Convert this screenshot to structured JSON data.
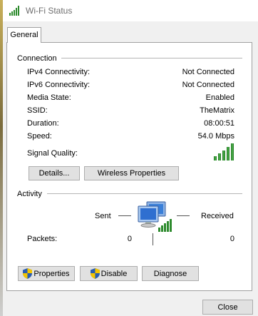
{
  "window": {
    "title": "Wi-Fi Status"
  },
  "tabs": [
    {
      "label": "General"
    }
  ],
  "connection": {
    "section_label": "Connection",
    "rows": [
      {
        "label": "IPv4 Connectivity:",
        "value": "Not Connected"
      },
      {
        "label": "IPv6 Connectivity:",
        "value": "Not Connected"
      },
      {
        "label": "Media State:",
        "value": "Enabled"
      },
      {
        "label": "SSID:",
        "value": "TheMatrix"
      },
      {
        "label": "Duration:",
        "value": "08:00:51"
      },
      {
        "label": "Speed:",
        "value": "54.0 Mbps"
      }
    ],
    "signal_label": "Signal Quality:",
    "signal_bars": 5,
    "details_button": "Details...",
    "wireless_properties_button": "Wireless Properties"
  },
  "activity": {
    "section_label": "Activity",
    "sent_label": "Sent",
    "received_label": "Received",
    "packets_label": "Packets:",
    "packets_sent": "0",
    "packets_received": "0"
  },
  "buttons": {
    "properties": "Properties",
    "disable": "Disable",
    "diagnose": "Diagnose",
    "close": "Close"
  },
  "colors": {
    "signal_green": "#2e8b2e",
    "shield_blue": "#2a5db0",
    "shield_yellow": "#f2c400"
  },
  "icons": {
    "title": "wifi-signal-icon",
    "network": "network-computers-icon",
    "shield": "uac-shield-icon"
  }
}
